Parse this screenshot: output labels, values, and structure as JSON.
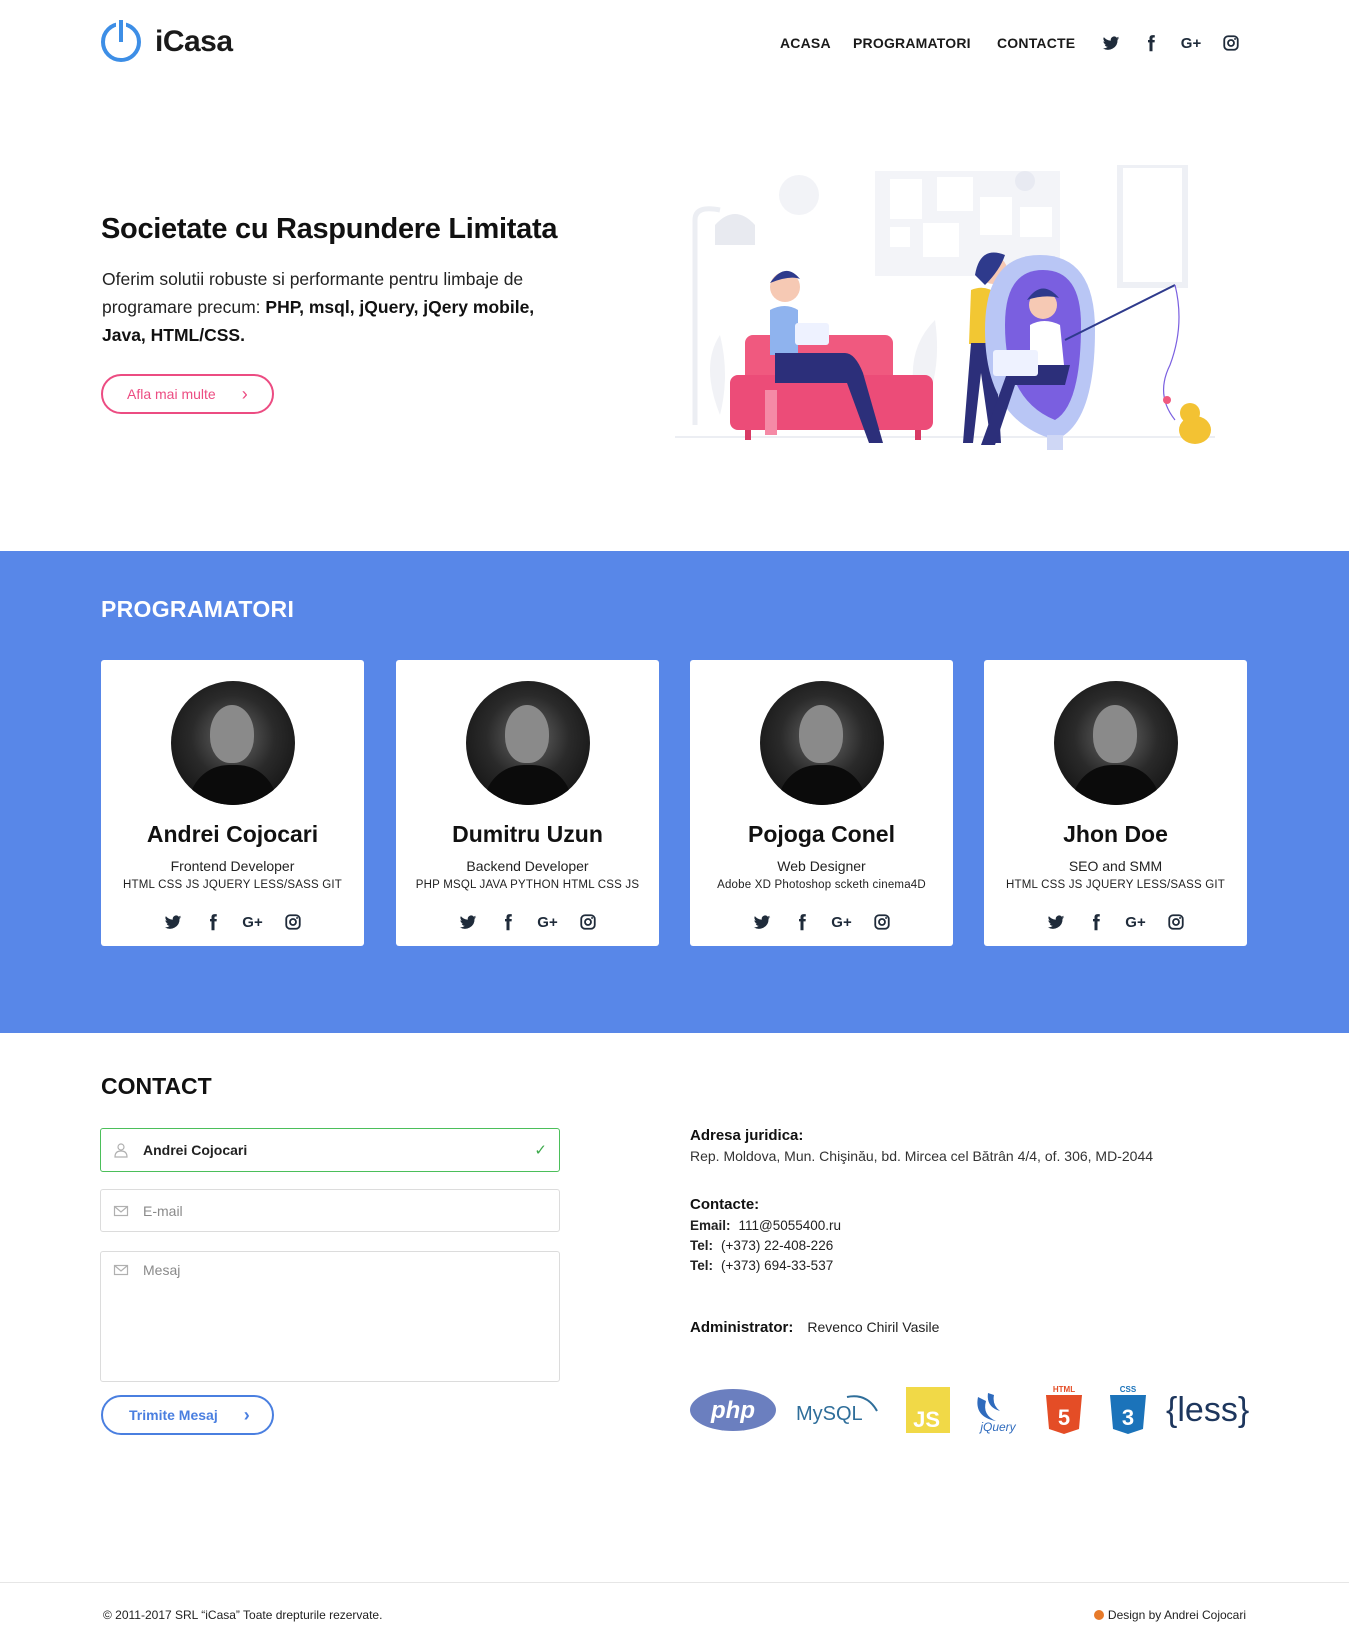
{
  "brand": {
    "name": "iCasa",
    "color": "#3d8ee6"
  },
  "nav": {
    "items": [
      "ACASA",
      "PROGRAMATORI",
      "CONTACTE"
    ]
  },
  "social_icons": [
    "twitter-icon",
    "facebook-icon",
    "google-plus-icon",
    "instagram-icon"
  ],
  "hero": {
    "title": "Societate cu Raspundere Limitata",
    "text_lead": "Oferim solutii robuste si performante pentru limbaje de programare precum: ",
    "text_bold": "PHP, msql, jQuery, jQery mobile, Java, HTML/CSS.",
    "button": "Afla mai multe",
    "accent": "#ec4c82"
  },
  "team": {
    "title": "PROGRAMATORI",
    "background": "#5887e8",
    "members": [
      {
        "name": "Andrei Cojocari",
        "role": "Frontend Developer",
        "skills": "HTML CSS JS JQUERY LESS/SASS GIT"
      },
      {
        "name": "Dumitru Uzun",
        "role": "Backend Developer",
        "skills": "PHP MSQL JAVA PYTHON HTML CSS JS"
      },
      {
        "name": "Pojoga Conel",
        "role": "Web Designer",
        "skills": "Adobe XD  Photoshop scketh cinema4D"
      },
      {
        "name": "Jhon Doe",
        "role": "SEO  and SMM",
        "skills": "HTML CSS JS JQUERY LESS/SASS GIT"
      }
    ]
  },
  "contact": {
    "title": "CONTACT",
    "name_value": "Andrei Cojocari",
    "email_placeholder": "E-mail",
    "message_placeholder": "Mesaj",
    "submit": "Trimite Mesaj",
    "address_label": "Adresa juridica:",
    "address": "Rep. Moldova, Mun. Chişinău, bd. Mircea cel Bătrân 4/4, of. 306, MD-2044",
    "contacts_label": "Contacte:",
    "email_label": "Email:",
    "email": "111@5055400.ru",
    "tel_label": "Tel:",
    "tel1": "(+373) 22-408-226",
    "tel2": "(+373) 694-33-537",
    "admin_label": "Administrator:",
    "admin": "Revenco Chiril Vasile"
  },
  "tech_logos": [
    "php",
    "MySQL",
    "JS",
    "jQuery",
    "HTML",
    "CSS",
    "{less}"
  ],
  "footer": {
    "copyright": "© 2011-2017 SRL “iCasa” Toate drepturile rezervate.",
    "credit": "Design by Andrei Cojocari"
  }
}
